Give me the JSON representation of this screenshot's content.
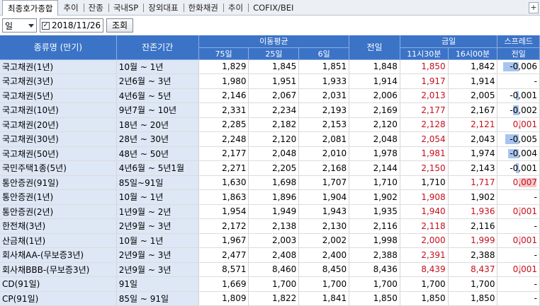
{
  "tabs": [
    {
      "label": "최종호가종합",
      "active": true
    },
    {
      "label": "추이"
    },
    {
      "label": "잔종"
    },
    {
      "label": "국내SP"
    },
    {
      "label": "장외대표"
    },
    {
      "label": "한화채권"
    },
    {
      "label": "추이"
    },
    {
      "label": "COFIX/BEI"
    }
  ],
  "tab_plus": "+",
  "controls": {
    "period_select": "일",
    "date": "2018/11/26",
    "query_button": "조회",
    "date_check": "✓"
  },
  "headers": {
    "name": "종류명 (만기)",
    "period": "잔존기간",
    "moving_avg": "이동평균",
    "ma75": "75일",
    "ma25": "25일",
    "ma6": "6일",
    "prev": "전일",
    "today": "금일",
    "t1130": "11시30분",
    "t1610": "16시00분",
    "spread": "스프레드",
    "spread_prev": "전일"
  },
  "rows": [
    {
      "name": "국고채권(1년)",
      "period": "10월 ~ 1년",
      "ma75": "1,829",
      "ma25": "1,845",
      "ma6": "1,851",
      "prev": "1,848",
      "t1130": "1,850",
      "t1610": "1,842",
      "spread": "-0,006",
      "spread_value": -0.006
    },
    {
      "name": "국고채권(3년)",
      "period": "2년6월 ~ 3년",
      "ma75": "1,980",
      "ma25": "1,951",
      "ma6": "1,933",
      "prev": "1,914",
      "t1130": "1,917",
      "t1610": "1,914",
      "spread": "-",
      "spread_value": 0
    },
    {
      "name": "국고채권(5년)",
      "period": "4년6월 ~ 5년",
      "ma75": "2,146",
      "ma25": "2,067",
      "ma6": "2,031",
      "prev": "2,006",
      "t1130": "2,013",
      "t1610": "2,005",
      "spread": "-0,001",
      "spread_value": -0.001
    },
    {
      "name": "국고채권(10년)",
      "period": "9년7월 ~ 10년",
      "ma75": "2,331",
      "ma25": "2,234",
      "ma6": "2,193",
      "prev": "2,169",
      "t1130": "2,177",
      "t1610": "2,167",
      "spread": "-0,002",
      "spread_value": -0.002
    },
    {
      "name": "국고채권(20년)",
      "period": "18년 ~ 20년",
      "ma75": "2,285",
      "ma25": "2,182",
      "ma6": "2,153",
      "prev": "2,120",
      "t1130": "2,128",
      "t1610": "2,121",
      "spread": "0,001",
      "spread_value": 0.001
    },
    {
      "name": "국고채권(30년)",
      "period": "28년 ~ 30년",
      "ma75": "2,248",
      "ma25": "2,120",
      "ma6": "2,081",
      "prev": "2,048",
      "t1130": "2,054",
      "t1610": "2,043",
      "spread": "-0,005",
      "spread_value": -0.005
    },
    {
      "name": "국고채권(50년)",
      "period": "48년 ~ 50년",
      "ma75": "2,177",
      "ma25": "2,048",
      "ma6": "2,010",
      "prev": "1,978",
      "t1130": "1,981",
      "t1610": "1,974",
      "spread": "-0,004",
      "spread_value": -0.004
    },
    {
      "name": "국민주택1종(5년)",
      "period": "4년6월 ~ 5년1월",
      "ma75": "2,271",
      "ma25": "2,205",
      "ma6": "2,168",
      "prev": "2,144",
      "t1130": "2,150",
      "t1610": "2,143",
      "spread": "-0,001",
      "spread_value": -0.001
    },
    {
      "name": "통안증권(91일)",
      "period": "85일~91일",
      "ma75": "1,630",
      "ma25": "1,698",
      "ma6": "1,707",
      "prev": "1,710",
      "t1130": "1,710",
      "t1610": "1,717",
      "spread": "0,007",
      "spread_value": 0.007
    },
    {
      "name": "통안증권(1년)",
      "period": "10월 ~ 1년",
      "ma75": "1,863",
      "ma25": "1,896",
      "ma6": "1,904",
      "prev": "1,902",
      "t1130": "1,908",
      "t1610": "1,902",
      "spread": "-",
      "spread_value": 0
    },
    {
      "name": "통안증권(2년)",
      "period": "1년9월 ~ 2년",
      "ma75": "1,954",
      "ma25": "1,949",
      "ma6": "1,943",
      "prev": "1,935",
      "t1130": "1,940",
      "t1610": "1,936",
      "spread": "0,001",
      "spread_value": 0.001
    },
    {
      "name": "한전채(3년)",
      "period": "2년9월 ~ 3년",
      "ma75": "2,172",
      "ma25": "2,138",
      "ma6": "2,130",
      "prev": "2,116",
      "t1130": "2,118",
      "t1610": "2,116",
      "spread": "-",
      "spread_value": 0
    },
    {
      "name": "산금채(1년)",
      "period": "10월 ~ 1년",
      "ma75": "1,967",
      "ma25": "2,003",
      "ma6": "2,002",
      "prev": "1,998",
      "t1130": "2,000",
      "t1610": "1,999",
      "spread": "0,001",
      "spread_value": 0.001
    },
    {
      "name": "회사채AA-(무보증3년)",
      "period": "2년9월 ~ 3년",
      "ma75": "2,477",
      "ma25": "2,408",
      "ma6": "2,400",
      "prev": "2,388",
      "t1130": "2,391",
      "t1610": "2,388",
      "spread": "-",
      "spread_value": 0
    },
    {
      "name": "회사채BBB-(무보증3년)",
      "period": "2년9월 ~ 3년",
      "ma75": "8,571",
      "ma25": "8,460",
      "ma6": "8,450",
      "prev": "8,436",
      "t1130": "8,439",
      "t1610": "8,437",
      "spread": "0,001",
      "spread_value": 0.001
    },
    {
      "name": "CD(91일)",
      "period": "91일",
      "ma75": "1,669",
      "ma25": "1,700",
      "ma6": "1,700",
      "prev": "1,700",
      "t1130": "1,700",
      "t1610": "1,700",
      "spread": "-",
      "spread_value": 0
    },
    {
      "name": "CP(91일)",
      "period": "85일 ~ 91일",
      "ma75": "1,809",
      "ma25": "1,822",
      "ma6": "1,841",
      "prev": "1,850",
      "t1130": "1,850",
      "t1610": "1,850",
      "spread": "-",
      "spread_value": 0
    }
  ],
  "colors": {
    "header_bg": "#3b73c7",
    "name_col_bg": "#dde7f5",
    "up": "#c4101c",
    "bar_neg": "#a8c4ee",
    "bar_pos": "#f6c9cb"
  }
}
